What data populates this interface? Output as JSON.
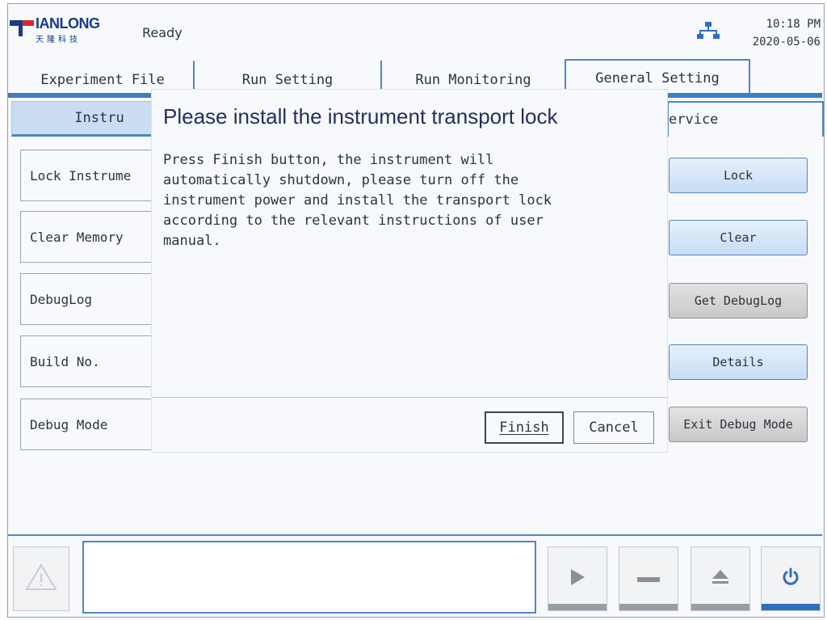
{
  "header": {
    "logo_text": "IANLONG",
    "logo_sub": "天隆科技",
    "status": "Ready",
    "time": "10:18 PM",
    "date": "2020-05-06",
    "network_icon": "network-icon"
  },
  "tabs": [
    {
      "label": "Experiment File"
    },
    {
      "label": "Run Setting"
    },
    {
      "label": "Run Monitoring"
    },
    {
      "label": "General Setting",
      "active": true
    }
  ],
  "subtabs": {
    "left_label": "Instru",
    "right_label": "ervice"
  },
  "rows": [
    {
      "label": "Lock Instrume",
      "button": "Lock"
    },
    {
      "label": "Clear Memory",
      "button": "Clear"
    },
    {
      "label": "DebugLog",
      "button": "Get DebugLog"
    },
    {
      "label": "Build No.",
      "button": "Details"
    },
    {
      "label": "Debug Mode",
      "button": "Exit Debug Mode"
    }
  ],
  "dialog": {
    "title": "Please install the instrument transport lock",
    "body": "Press Finish button, the instrument will\nautomatically shutdown, please turn off the\ninstrument power and install the transport lock\naccording to the relevant instructions of user\nmanual.",
    "finish_label": "Finish",
    "cancel_label": "Cancel"
  },
  "controls": {
    "warning_icon": "warning-icon",
    "message": "",
    "play_icon": "play-icon",
    "stop_icon": "stop-icon",
    "eject_icon": "eject-icon",
    "power_icon": "power-icon"
  },
  "colors": {
    "accent": "#4f86c6",
    "title": "#22305e",
    "logo_blue": "#1a3a8c",
    "logo_red": "#e0262c"
  }
}
